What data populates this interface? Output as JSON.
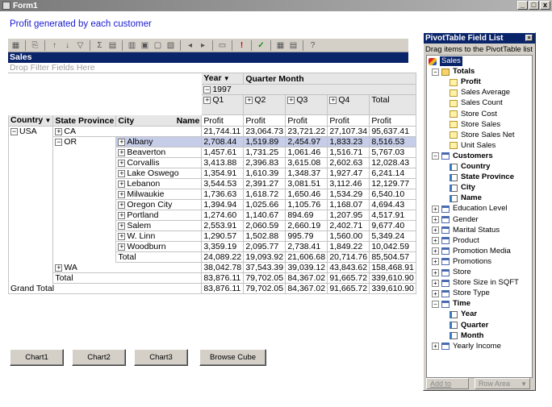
{
  "window": {
    "title": "Form1",
    "min": "_",
    "max": "□",
    "close": "x"
  },
  "heading": "Profit generated by each customer",
  "pivot": {
    "title": "Sales",
    "filter_hint": "Drop Filter Fields Here",
    "col_field_year": "Year",
    "col_field_quarter": "Quarter Month",
    "year": "1997",
    "quarters": [
      "Q1",
      "Q2",
      "Q3",
      "Q4",
      "Total"
    ],
    "measure": "Profit",
    "row_fields": {
      "country": "Country",
      "state": "State Province",
      "city": "City",
      "name": "Name"
    },
    "rows": [
      {
        "country": "USA",
        "state": "CA",
        "city": "",
        "values": [
          "21,744.11",
          "23,064.73",
          "23,721.22",
          "27,107.34",
          "95,637.41"
        ]
      },
      {
        "country": "",
        "state": "OR",
        "city": "Albany",
        "values": [
          "2,708.44",
          "1,519.89",
          "2,454.97",
          "1,833.23",
          "8,516.53"
        ]
      },
      {
        "country": "",
        "state": "",
        "city": "Beaverton",
        "values": [
          "1,457.61",
          "1,731.25",
          "1,061.46",
          "1,516.71",
          "5,767.03"
        ]
      },
      {
        "country": "",
        "state": "",
        "city": "Corvallis",
        "values": [
          "3,413.88",
          "2,396.83",
          "3,615.08",
          "2,602.63",
          "12,028.43"
        ]
      },
      {
        "country": "",
        "state": "",
        "city": "Lake Oswego",
        "values": [
          "1,354.91",
          "1,610.39",
          "1,348.37",
          "1,927.47",
          "6,241.14"
        ]
      },
      {
        "country": "",
        "state": "",
        "city": "Lebanon",
        "values": [
          "3,544.53",
          "2,391.27",
          "3,081.51",
          "3,112.46",
          "12,129.77"
        ]
      },
      {
        "country": "",
        "state": "",
        "city": "Milwaukie",
        "values": [
          "1,736.63",
          "1,618.72",
          "1,650.46",
          "1,534.29",
          "6,540.10"
        ]
      },
      {
        "country": "",
        "state": "",
        "city": "Oregon City",
        "values": [
          "1,394.94",
          "1,025.66",
          "1,105.76",
          "1,168.07",
          "4,694.43"
        ]
      },
      {
        "country": "",
        "state": "",
        "city": "Portland",
        "values": [
          "1,274.60",
          "1,140.67",
          "894.69",
          "1,207.95",
          "4,517.91"
        ]
      },
      {
        "country": "",
        "state": "",
        "city": "Salem",
        "values": [
          "2,553.91",
          "2,060.59",
          "2,660.19",
          "2,402.71",
          "9,677.40"
        ]
      },
      {
        "country": "",
        "state": "",
        "city": "W. Linn",
        "values": [
          "1,290.57",
          "1,502.88",
          "995.79",
          "1,560.00",
          "5,349.24"
        ]
      },
      {
        "country": "",
        "state": "",
        "city": "Woodburn",
        "values": [
          "3,359.19",
          "2,095.77",
          "2,738.41",
          "1,849.22",
          "10,042.59"
        ]
      },
      {
        "country": "",
        "state": "",
        "city": "Total",
        "values": [
          "24,089.22",
          "19,093.92",
          "21,606.68",
          "20,714.76",
          "85,504.57"
        ]
      },
      {
        "country": "",
        "state": "WA",
        "city": "",
        "values": [
          "38,042.78",
          "37,543.39",
          "39,039.12",
          "43,843.62",
          "158,468.91"
        ]
      },
      {
        "country": "",
        "state": "Total",
        "city": "",
        "values": [
          "83,876.11",
          "79,702.05",
          "84,367.02",
          "91,665.72",
          "339,610.90"
        ]
      },
      {
        "country": "Grand Total",
        "state": "",
        "city": "",
        "values": [
          "83,876.11",
          "79,702.05",
          "84,367.02",
          "91,665.72",
          "339,610.90"
        ]
      }
    ]
  },
  "buttons": {
    "chart1": "Chart1",
    "chart2": "Chart2",
    "chart3": "Chart3",
    "browse": "Browse Cube"
  },
  "field_list": {
    "title": "PivotTable Field List",
    "subtitle": "Drag items to the PivotTable list",
    "cube": "Sales",
    "totals": "Totals",
    "measures": [
      "Profit",
      "Sales Average",
      "Sales Count",
      "Store Cost",
      "Store Sales",
      "Store Sales Net",
      "Unit Sales"
    ],
    "customers": "Customers",
    "customer_levels": [
      "Country",
      "State Province",
      "City",
      "Name"
    ],
    "dimensions": [
      "Education Level",
      "Gender",
      "Marital Status",
      "Product",
      "Promotion Media",
      "Promotions",
      "Store",
      "Store Size in SQFT",
      "Store Type"
    ],
    "time": "Time",
    "time_levels": [
      "Year",
      "Quarter",
      "Month"
    ],
    "yearly_income": "Yearly Income",
    "add_to": "Add to",
    "area": "Row Area"
  }
}
